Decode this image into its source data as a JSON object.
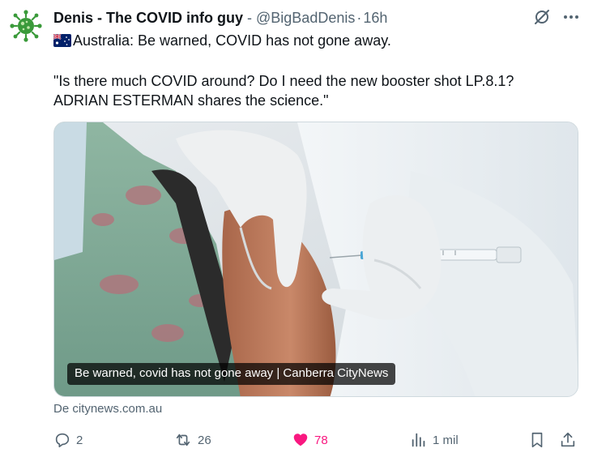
{
  "post": {
    "author": "Denis - The COVID info guy",
    "separator_dash": "-",
    "handle": "@BigBadDenis",
    "separator_dot": "·",
    "time": "16h",
    "text_line1": "Australia: Be warned, COVID has not gone away.",
    "text_line2": "\"Is there much COVID around? Do I need the new booster shot LP.8.1?",
    "text_line3": "ADRIAN ESTERMAN shares the science.\"",
    "flag_icon": "australia-flag-icon"
  },
  "media": {
    "caption": "Be warned, covid has not gone away | Canberra CityNews",
    "source": "De citynews.com.au"
  },
  "actions": {
    "reply_count": "2",
    "repost_count": "26",
    "like_count": "78",
    "views_count": "1 mil"
  },
  "colors": {
    "like": "#f91880",
    "muted": "#536471",
    "avatar_green": "#3a9a3a"
  }
}
